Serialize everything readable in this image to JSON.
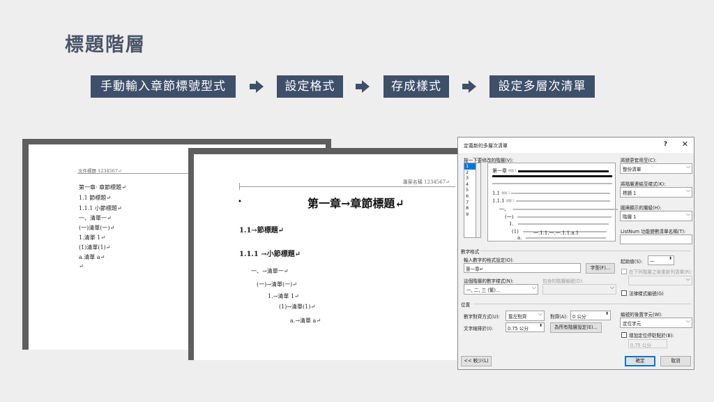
{
  "slide": {
    "title": "標題階層"
  },
  "flow": {
    "steps": [
      "手動輸入章節標號型式",
      "設定格式",
      "存成樣式",
      "設定多層次清單"
    ]
  },
  "doc1": {
    "header": "文件標題 1234567↵",
    "lines": [
      "第一章· 章節標題↵",
      "1.1 節標題↵",
      "1.1.1 小節標題↵",
      "一、清單一↵",
      "(一)清單(一)↵",
      "1.清單 1↵",
      "(1)清單(1)↵",
      "a.清單 a↵",
      "↵"
    ]
  },
  "doc2": {
    "header": "專案名稱 1234567↵",
    "chapter": "第一章→章節標題↵",
    "lines": [
      "1.1→節標題↵",
      "1.1.1 →小節標題↵",
      "一、→清單一↵",
      "(一)→清單(一)↵",
      "1.→清單 1↵",
      "(1)→清單(1)↵",
      "a.→清單 a↵"
    ]
  },
  "dialog": {
    "title": "定義新的多層次清單",
    "help": "?",
    "close": "✕",
    "level_label": "按一下要修改的階層(V):",
    "levels": [
      "1",
      "2",
      "3",
      "4",
      "5",
      "6",
      "7",
      "8",
      "9"
    ],
    "preview": {
      "chapter": "第一章",
      "rows": [
        "1.1",
        "1.1.1",
        "一、",
        "(一)",
        "1.",
        "(1)",
        "a.",
        "一.1.1.一.一.1.1.a.1"
      ],
      "tags": [
        "標題 1",
        "標題 2",
        "標題 3",
        "",
        "",
        "",
        "",
        "",
        ""
      ]
    },
    "apply_to_label": "將變更套用至(C):",
    "apply_to_value": "整份清單",
    "link_style_label": "將階層連結至樣式(K):",
    "link_style_value": "標題 1",
    "gallery_level_label": "圖庫顯示的層級(H):",
    "gallery_level_value": "階層 1",
    "listnum_label": "ListNum 功能變數清單名稱(T):",
    "listnum_value": "",
    "number_format_section": "數字格式",
    "enter_format_label": "輸入數字的格式設定(O):",
    "enter_format_value": "第一章↵",
    "font_button": "字型(F)...",
    "number_style_label": "這個階層的數字樣式(N):",
    "number_style_value": "一, 二, 三 (繁)...",
    "include_level_label": "包含的階層編號(D):",
    "start_at_label": "起始值(S):",
    "start_at_value": "一",
    "restart_label": "在下列階層之後重新列清單(R):",
    "legal_label": "法律樣式編號(G)",
    "position_section": "位置",
    "alignment_label": "數字對齊方式(U):",
    "alignment_value": "靠左對齊",
    "aligned_at_label": "對齊(A):",
    "aligned_at_value": "0 公分",
    "indent_label": "文字縮排於(I):",
    "indent_value": "0.75 公分",
    "set_all_button": "為所有階層設定(E)...",
    "follow_label": "編號的後置字元(W):",
    "follow_value": "定位字元",
    "tab_stop_label": "增加定位停駐點於(B):",
    "tab_stop_value": "0.75 公分",
    "less_button": "<< 較少(L)",
    "ok_button": "確定",
    "cancel_button": "取消"
  }
}
